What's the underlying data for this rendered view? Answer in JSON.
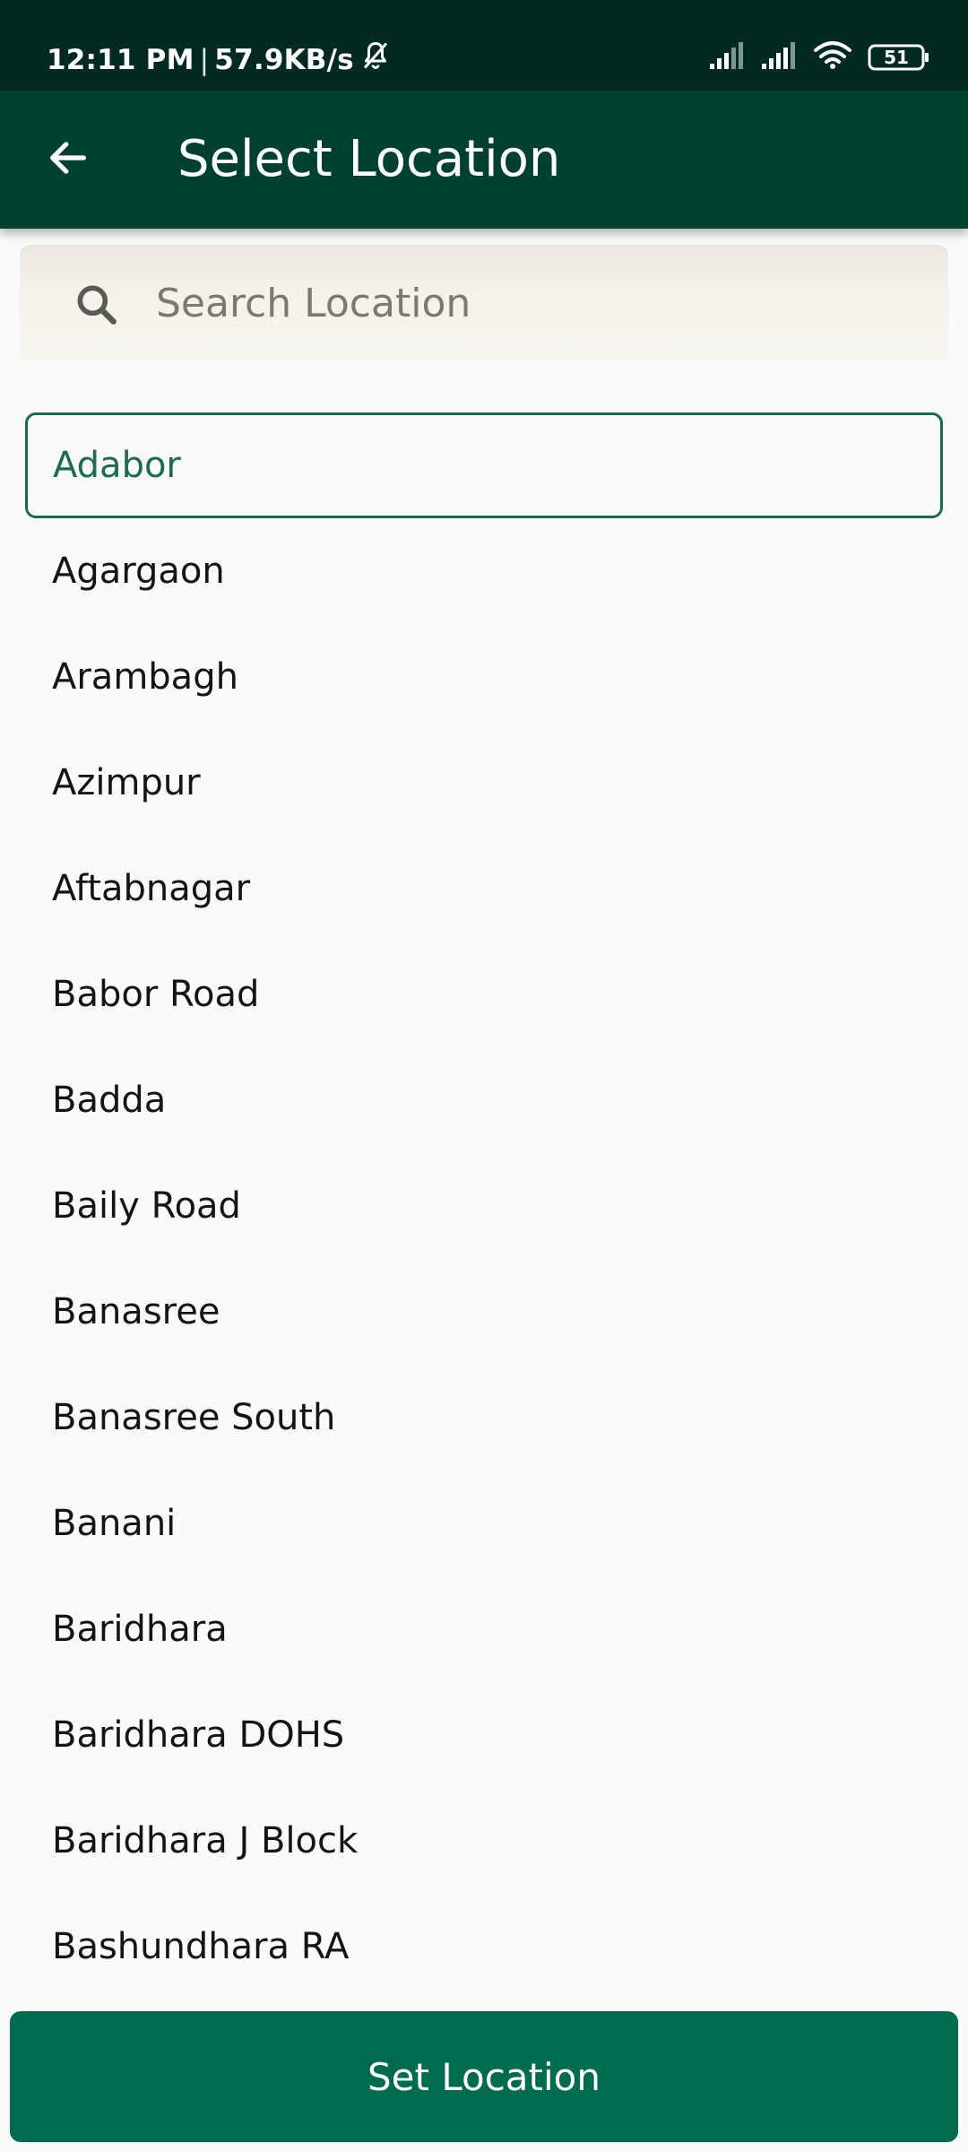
{
  "status_bar": {
    "time": "12:11 PM",
    "separator": "|",
    "network_speed": "57.9KB/s",
    "battery": "51",
    "icons": [
      "bell-muted-icon",
      "signal-icon",
      "signal-icon",
      "wifi-icon",
      "battery-icon"
    ]
  },
  "app_bar": {
    "title": "Select Location",
    "back_icon": "arrow-left-icon"
  },
  "search": {
    "placeholder": "Search Location",
    "value": "",
    "icon": "search-icon"
  },
  "locations": [
    {
      "label": "Adabor",
      "selected": true
    },
    {
      "label": "Agargaon"
    },
    {
      "label": "Arambagh"
    },
    {
      "label": "Azimpur"
    },
    {
      "label": "Aftabnagar"
    },
    {
      "label": "Babor Road"
    },
    {
      "label": "Badda"
    },
    {
      "label": "Baily Road"
    },
    {
      "label": "Banasree"
    },
    {
      "label": "Banasree South"
    },
    {
      "label": "Banani"
    },
    {
      "label": "Baridhara"
    },
    {
      "label": "Baridhara DOHS"
    },
    {
      "label": "Baridhara J Block"
    },
    {
      "label": "Bashundhara RA"
    }
  ],
  "footer": {
    "set_location_label": "Set Location"
  },
  "colors": {
    "status_bar_bg": "#022a22",
    "app_bar_bg": "#004030",
    "accent": "#1b6a52",
    "button_bg": "#006b4f",
    "page_bg": "#fafafa"
  }
}
